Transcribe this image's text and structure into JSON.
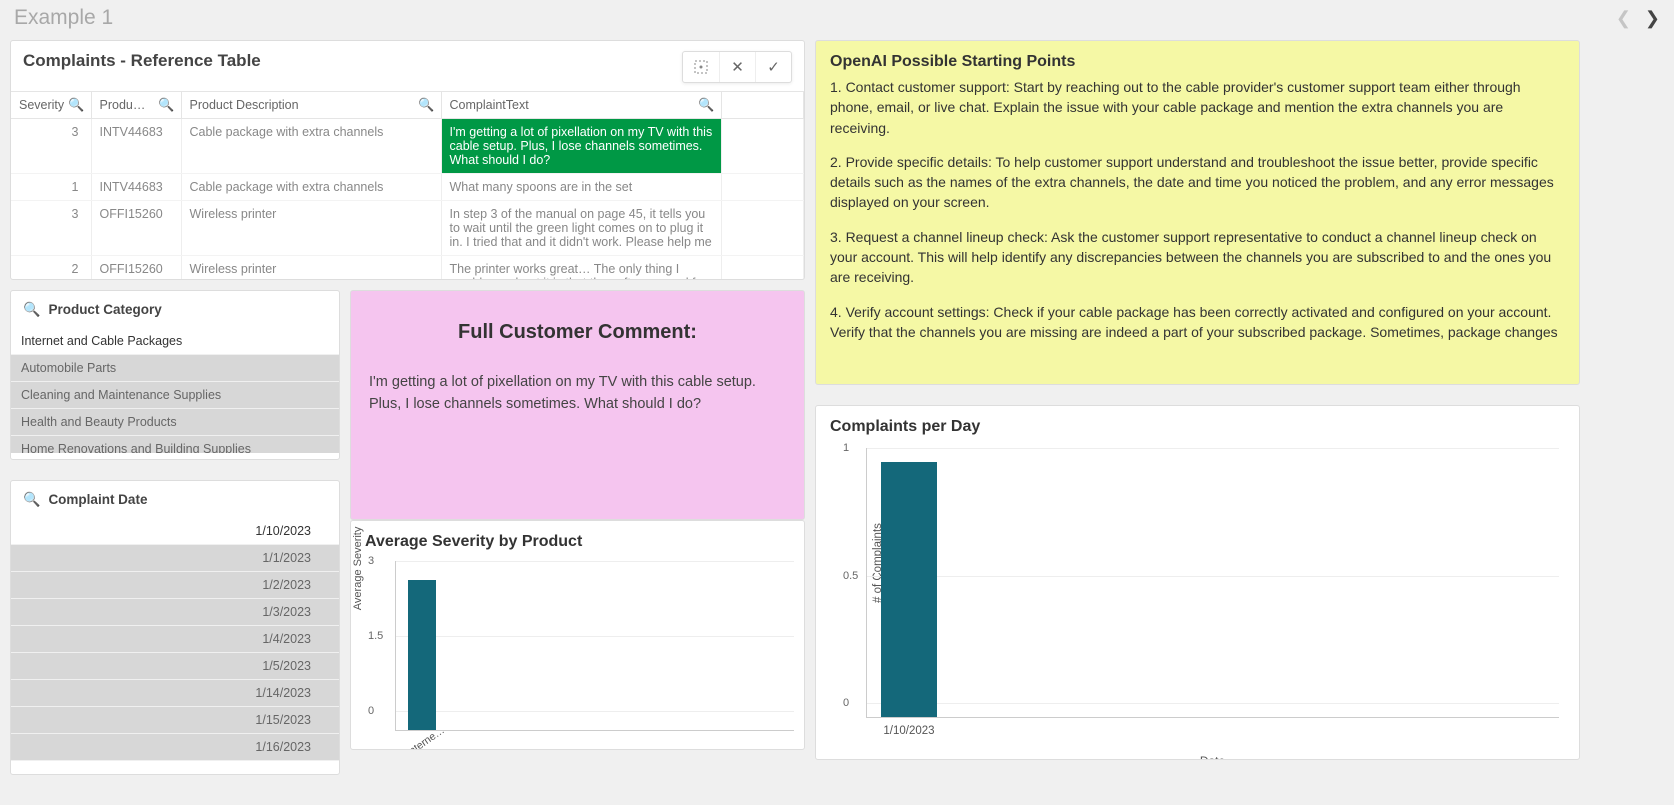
{
  "page": {
    "title": "Example 1"
  },
  "complaints_table": {
    "title": "Complaints - Reference Table",
    "columns": {
      "severity": "Severity",
      "product": "Produ…",
      "desc": "Product Description",
      "complaint": "ComplaintText"
    },
    "rows": [
      {
        "severity": "3",
        "product": "INTV44683",
        "desc": "Cable package with extra channels",
        "complaint": "I'm getting a lot of pixellation on my TV with this cable setup. Plus, I lose channels sometimes. What should I do?",
        "selected": true
      },
      {
        "severity": "1",
        "product": "INTV44683",
        "desc": "Cable package with extra channels",
        "complaint": "What many spoons are in the set"
      },
      {
        "severity": "3",
        "product": "OFFI15260",
        "desc": "Wireless printer",
        "complaint": "In step 3 of the manual on page 45, it tells you to wait until the green light comes on to plug it in. I tried that and it didn't work. Please help me"
      },
      {
        "severity": "2",
        "product": "OFFI15260",
        "desc": "Wireless printer",
        "complaint": "The printer works great… The only thing I would say about it is that the software used for it does"
      }
    ]
  },
  "ai_panel": {
    "title": "OpenAI Possible Starting Points",
    "paragraphs": [
      "1. Contact customer support: Start by reaching out to the cable provider's customer support team either through phone, email, or live chat. Explain the issue with your cable package and mention the extra channels you are receiving.",
      "2. Provide specific details: To help customer support understand and troubleshoot the issue better, provide specific details such as the names of the extra channels, the date and time you noticed the problem, and any error messages displayed on your screen.",
      "3. Request a channel lineup check: Ask the customer support representative to conduct a channel lineup check on your account. This will help identify any discrepancies between the channels you are subscribed to and the ones you are receiving.",
      "4. Verify account settings: Check if your cable package has been correctly activated and configured on your account. Verify that the channels you are missing are indeed a part of your subscribed package. Sometimes, package changes"
    ]
  },
  "prodcat": {
    "title": "Product Category",
    "items": [
      {
        "label": "Internet and Cable Packages",
        "active": true
      },
      {
        "label": "Automobile Parts"
      },
      {
        "label": "Cleaning and Maintenance Supplies"
      },
      {
        "label": "Health and Beauty Products"
      },
      {
        "label": "Home Renovations and Building Supplies"
      }
    ]
  },
  "dates": {
    "title": "Complaint Date",
    "items": [
      {
        "label": "1/10/2023",
        "active": true
      },
      {
        "label": "1/1/2023"
      },
      {
        "label": "1/2/2023"
      },
      {
        "label": "1/3/2023"
      },
      {
        "label": "1/4/2023"
      },
      {
        "label": "1/5/2023"
      },
      {
        "label": "1/14/2023"
      },
      {
        "label": "1/15/2023"
      },
      {
        "label": "1/16/2023"
      }
    ]
  },
  "comment": {
    "title": "Full Customer Comment:",
    "body": "I'm getting a lot of pixellation on my TV with this cable setup. Plus, I lose channels sometimes. What should I do?"
  },
  "sev_chart": {
    "title": "Average Severity by Product"
  },
  "cpd_chart": {
    "title": "Complaints per Day"
  },
  "chart_data": [
    {
      "id": "avg_severity",
      "type": "bar",
      "title": "Average Severity by Product",
      "ylabel": "Average Severity",
      "xlabel": "",
      "ylim": [
        0,
        3
      ],
      "yticks": [
        0,
        1.5,
        3
      ],
      "categories": [
        "Interne…"
      ],
      "values": [
        3
      ]
    },
    {
      "id": "complaints_per_day",
      "type": "bar",
      "title": "Complaints per Day",
      "ylabel": "# of Complaints",
      "xlabel": "Date",
      "ylim": [
        0,
        1
      ],
      "yticks": [
        0,
        0.5,
        1
      ],
      "categories": [
        "1/10/2023"
      ],
      "values": [
        1
      ]
    }
  ]
}
